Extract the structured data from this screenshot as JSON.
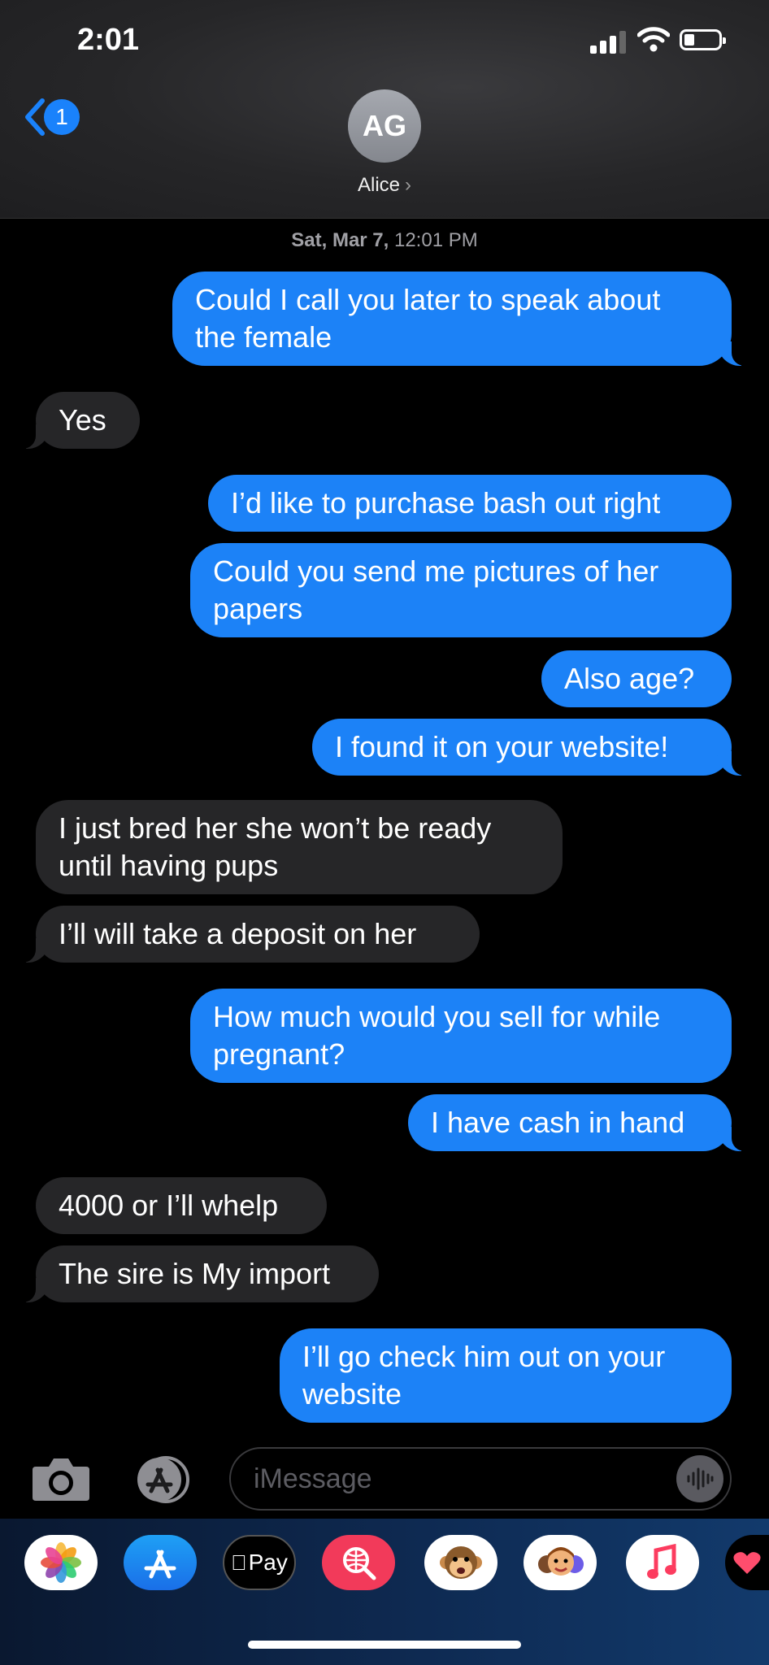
{
  "status_bar": {
    "time": "2:01"
  },
  "header": {
    "back_badge": "1",
    "avatar_initials": "AG",
    "contact_name": "Alice",
    "contact_chevron": "›"
  },
  "timestamp": {
    "day": "Sat, Mar 7,",
    "time": "12:01 PM"
  },
  "messages": [
    {
      "direction": "out",
      "text": "Could I call you later to speak about\nthe female"
    },
    {
      "direction": "in",
      "text": "Yes"
    },
    {
      "direction": "out",
      "text": "I’d like to purchase bash out right"
    },
    {
      "direction": "out",
      "text": "Could you send me pictures of her\npapers"
    },
    {
      "direction": "out",
      "text": "Also age?"
    },
    {
      "direction": "out",
      "text": "I found it on your website!"
    },
    {
      "direction": "in",
      "text": "I just bred her she won’t be ready\nuntil having pups"
    },
    {
      "direction": "in",
      "text": "I’ll will take a deposit on her"
    },
    {
      "direction": "out",
      "text": "How much would you sell for while\npregnant?"
    },
    {
      "direction": "out",
      "text": "I have cash in hand"
    },
    {
      "direction": "in",
      "text": "4000 or I’ll whelp"
    },
    {
      "direction": "in",
      "text": "The sire is My import"
    },
    {
      "direction": "out",
      "text": "I’ll go check him out on your\nwebsite"
    }
  ],
  "compose": {
    "placeholder": "iMessage"
  },
  "app_drawer": {
    "apps": [
      {
        "name": "photos-app-icon",
        "label": ""
      },
      {
        "name": "app-store-app-icon",
        "label": ""
      },
      {
        "name": "apple-pay-app-icon",
        "label": "Pay"
      },
      {
        "name": "search-images-app-icon",
        "label": ""
      },
      {
        "name": "animoji-monkey-app-icon",
        "label": ""
      },
      {
        "name": "memoji-app-icon",
        "label": ""
      },
      {
        "name": "music-app-icon",
        "label": ""
      },
      {
        "name": "heart-sticker-app-icon",
        "label": ""
      }
    ]
  },
  "colors": {
    "outgoing": "#1c82f7",
    "incoming": "#262628",
    "accent": "#1a82fb"
  }
}
